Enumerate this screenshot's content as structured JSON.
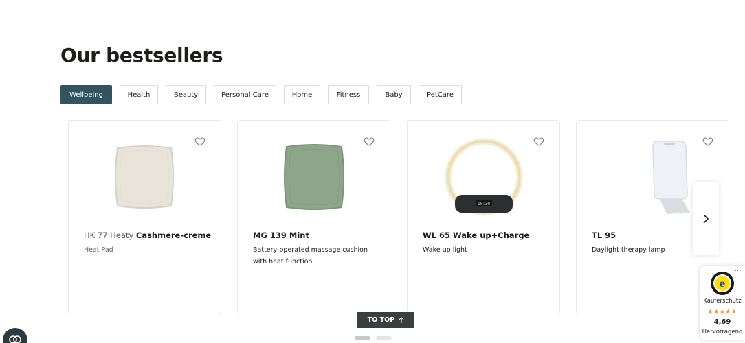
{
  "heading": "Our bestsellers",
  "tabs": [
    {
      "label": "Wellbeing",
      "active": true
    },
    {
      "label": "Health"
    },
    {
      "label": "Beauty"
    },
    {
      "label": "Personal Care"
    },
    {
      "label": "Home"
    },
    {
      "label": "Fitness"
    },
    {
      "label": "Baby"
    },
    {
      "label": "PetCare"
    }
  ],
  "products": [
    {
      "title_light": "HK 77 Heaty ",
      "title_bold": "Cashmere-creme",
      "desc": "Heat Pad",
      "image": "beige-cushion-heat-pad"
    },
    {
      "title_light": "",
      "title_bold": "MG 139 Mint",
      "desc": "Battery-operated massage cushion with heat function",
      "image": "mint-massage-cushion"
    },
    {
      "title_light": "",
      "title_bold": "WL 65 Wake up+Charge",
      "desc": "Wake up light",
      "image": "ring-wake-up-light"
    },
    {
      "title_light": "",
      "title_bold": "TL 95",
      "desc": "Daylight therapy lamp",
      "image": "daylight-therapy-lamp"
    }
  ],
  "totop": "TO TOP",
  "pagination": {
    "total": 2,
    "current": 1
  },
  "trust_badge": {
    "label": "Käuferschutz",
    "stars": "★★★★★",
    "score": "4,69",
    "rating": "Hervorragend",
    "more": "..."
  },
  "colors": {
    "accent": "#33535f",
    "stars": "#f28a17"
  },
  "icons": {
    "wishlist": "heart-icon",
    "next": "chevron-right-icon",
    "totop": "arrow-up-icon",
    "chat": "chat-icon"
  }
}
